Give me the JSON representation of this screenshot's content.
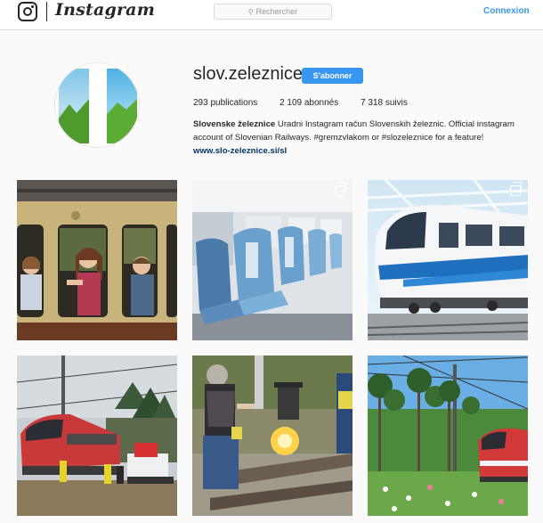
{
  "header": {
    "brand": "Instagram",
    "search_placeholder": "Rechercher",
    "login_label": "Connexion"
  },
  "profile": {
    "username": "slov.zeleznice",
    "follow_label": "S'abonner",
    "stats": {
      "publications": "293 publications",
      "followers": "2 109 abonnés",
      "following": "7 318 suivis"
    },
    "bio": {
      "name": "Slovenske železnice",
      "text": " Uradni Instagram račun Slovenskih železnic. Official instagram account of Slovenian Railways. #gremzvlakom or #slozeleznice for a feature!",
      "link": "www.slo-zeleznice.si/sl"
    }
  },
  "colors": {
    "accent": "#3897f0",
    "link": "#003569",
    "border": "#dbdbdb",
    "background": "#fafafa"
  },
  "posts": [
    {
      "subject": "children-at-train-window",
      "multi": false
    },
    {
      "subject": "blue-train-seats",
      "multi": true
    },
    {
      "subject": "white-blue-train",
      "multi": true
    },
    {
      "subject": "red-train-construction",
      "multi": false
    },
    {
      "subject": "rail-welding-worker",
      "multi": false
    },
    {
      "subject": "red-train-pine-trees",
      "multi": false
    }
  ]
}
